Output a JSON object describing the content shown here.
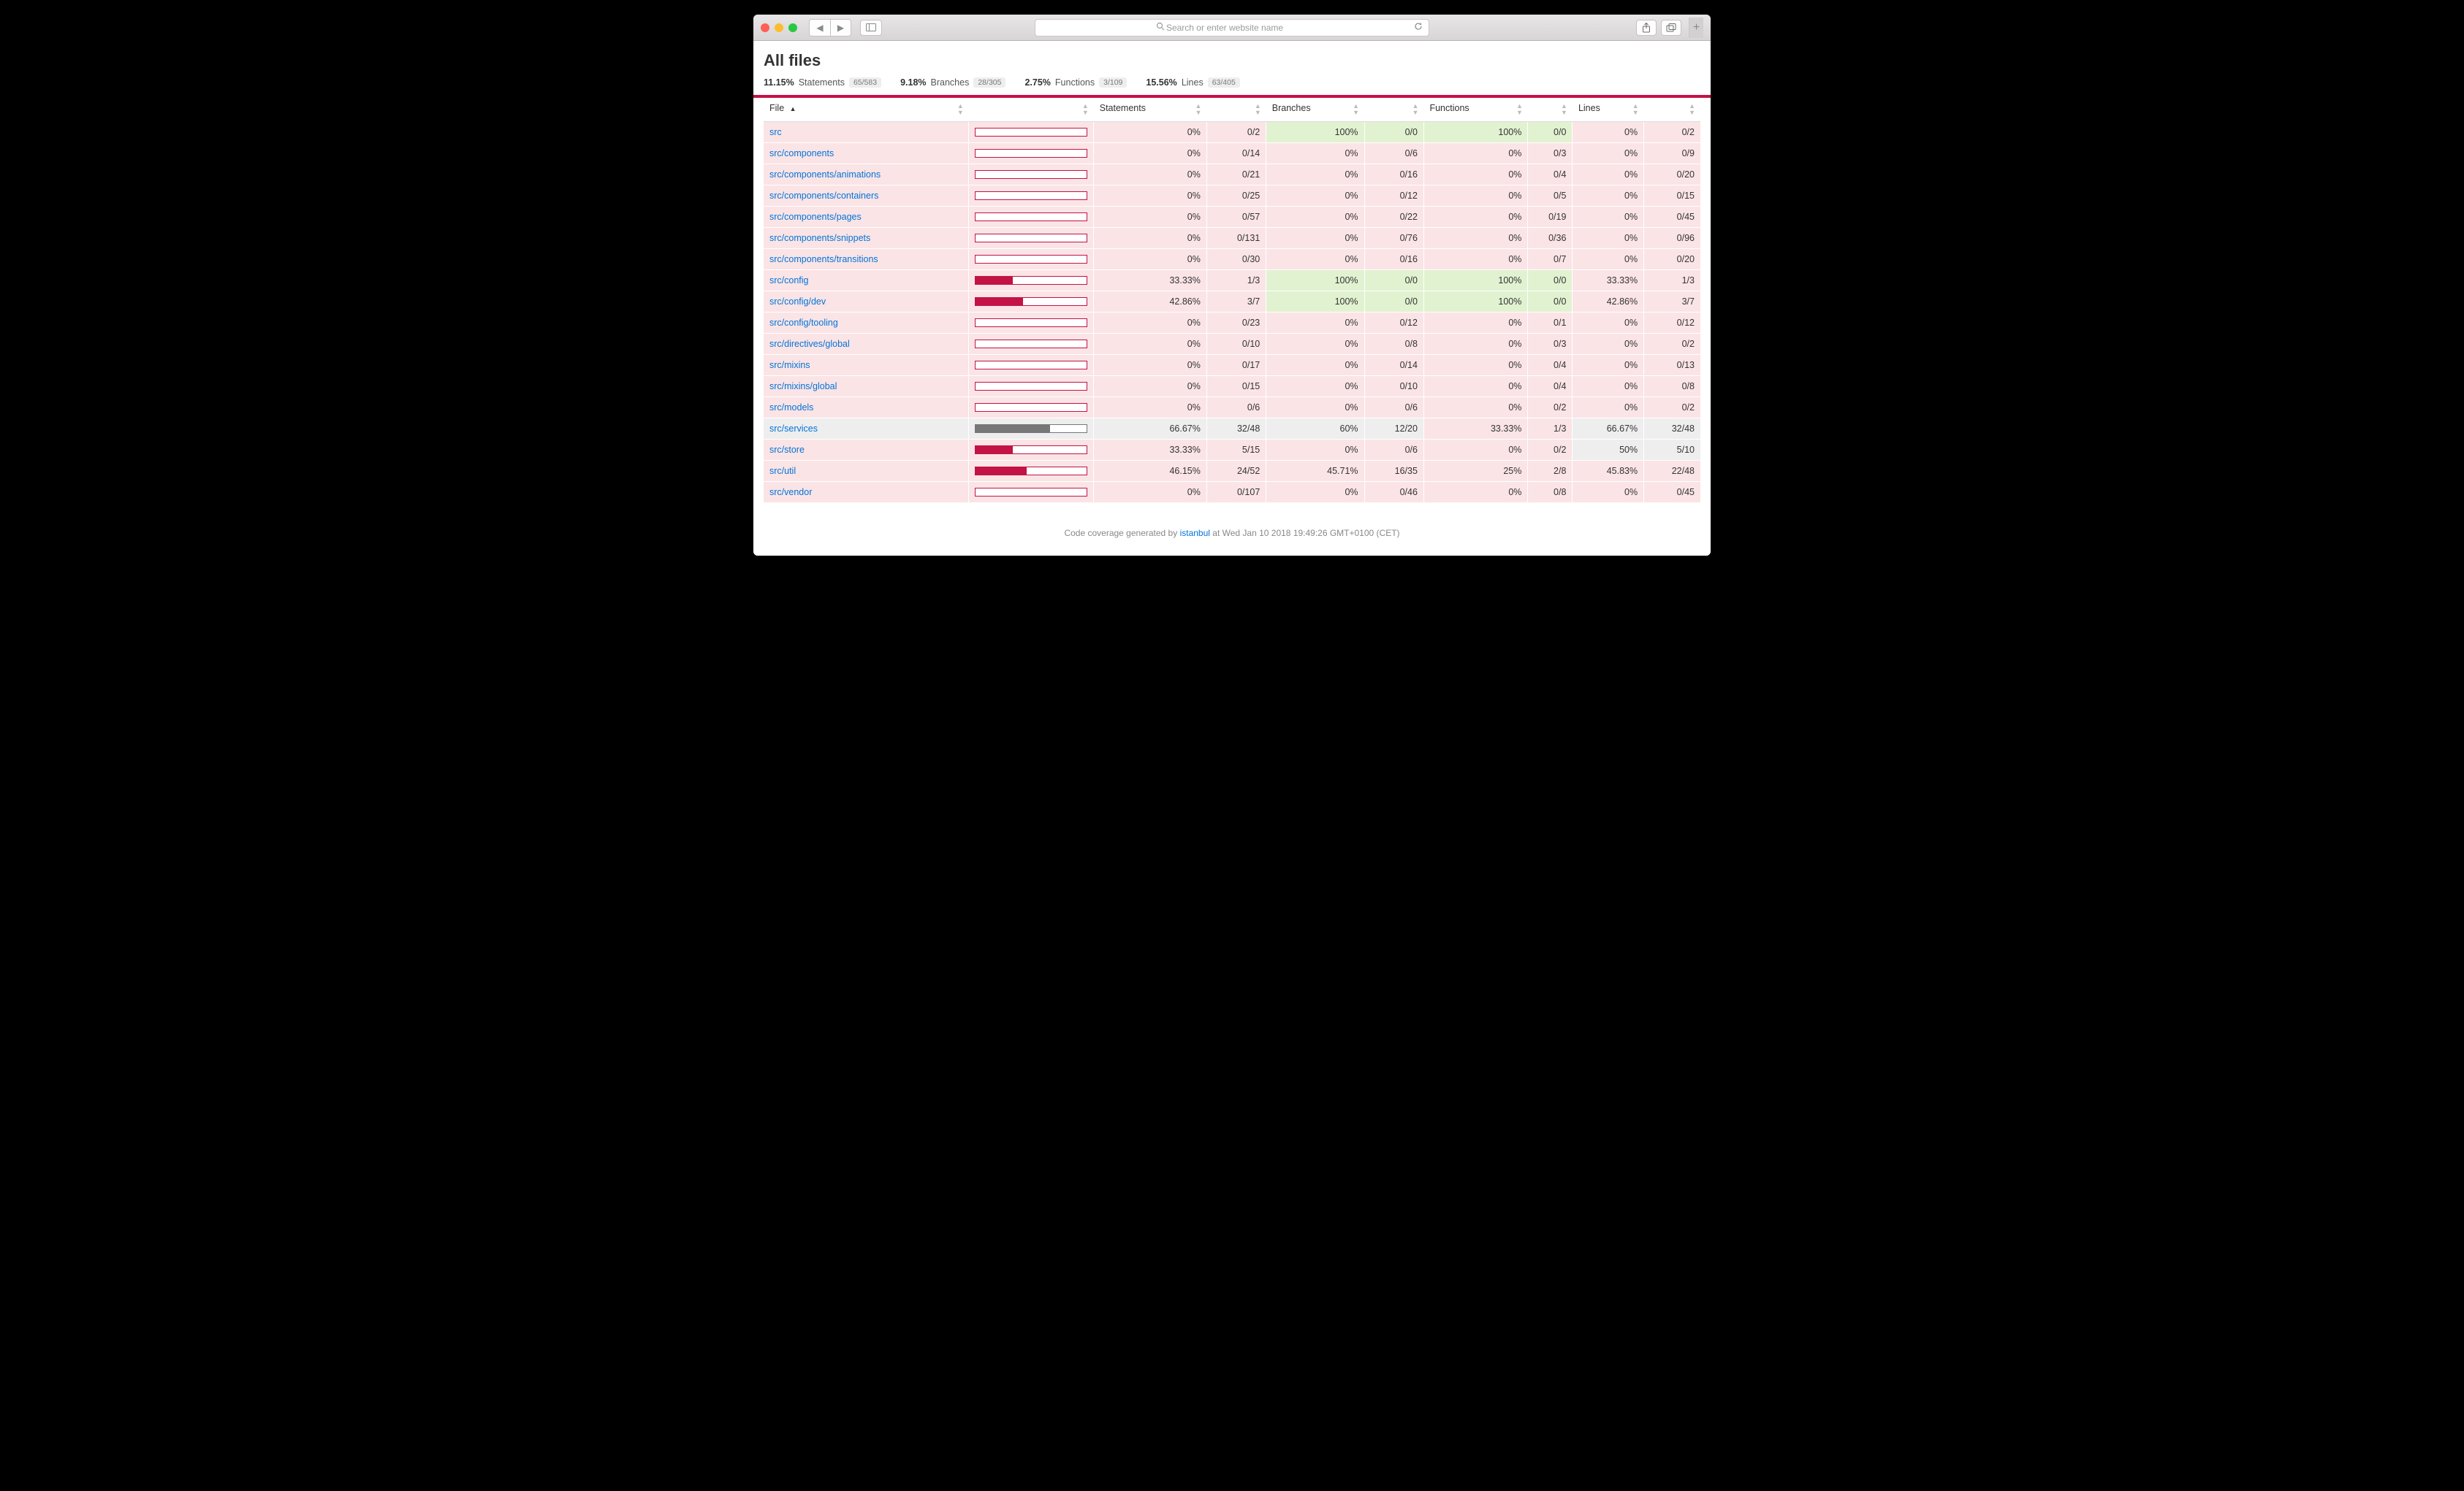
{
  "browser": {
    "url_placeholder": "Search or enter website name"
  },
  "page_title": "All files",
  "summary": [
    {
      "pct": "11.15%",
      "label": "Statements",
      "frac": "65/583"
    },
    {
      "pct": "9.18%",
      "label": "Branches",
      "frac": "28/305"
    },
    {
      "pct": "2.75%",
      "label": "Functions",
      "frac": "3/109"
    },
    {
      "pct": "15.56%",
      "label": "Lines",
      "frac": "63/405"
    }
  ],
  "columns": {
    "file": "File",
    "statements": "Statements",
    "branches": "Branches",
    "functions": "Functions",
    "lines": "Lines"
  },
  "accent": "#c21246",
  "rows": [
    {
      "file": "src",
      "bar": 0,
      "st_pct": "0%",
      "st_frac": "0/2",
      "br_pct": "100%",
      "br_frac": "0/0",
      "fn_pct": "100%",
      "fn_frac": "0/0",
      "ln_pct": "0%",
      "ln_frac": "0/2",
      "cls": {
        "file": "bg-low",
        "bar": "bg-low",
        "st_pct": "bg-low",
        "st_frac": "bg-low",
        "br_pct": "bg-high",
        "br_frac": "bg-high",
        "fn_pct": "bg-high",
        "fn_frac": "bg-high",
        "ln_pct": "bg-low",
        "ln_frac": "bg-low"
      }
    },
    {
      "file": "src/components",
      "bar": 0,
      "st_pct": "0%",
      "st_frac": "0/14",
      "br_pct": "0%",
      "br_frac": "0/6",
      "fn_pct": "0%",
      "fn_frac": "0/3",
      "ln_pct": "0%",
      "ln_frac": "0/9",
      "cls": {
        "file": "bg-low",
        "bar": "bg-low",
        "st_pct": "bg-low",
        "st_frac": "bg-low",
        "br_pct": "bg-low",
        "br_frac": "bg-low",
        "fn_pct": "bg-low",
        "fn_frac": "bg-low",
        "ln_pct": "bg-low",
        "ln_frac": "bg-low"
      }
    },
    {
      "file": "src/components/animations",
      "bar": 0,
      "st_pct": "0%",
      "st_frac": "0/21",
      "br_pct": "0%",
      "br_frac": "0/16",
      "fn_pct": "0%",
      "fn_frac": "0/4",
      "ln_pct": "0%",
      "ln_frac": "0/20",
      "cls": {
        "file": "bg-low",
        "bar": "bg-low",
        "st_pct": "bg-low",
        "st_frac": "bg-low",
        "br_pct": "bg-low",
        "br_frac": "bg-low",
        "fn_pct": "bg-low",
        "fn_frac": "bg-low",
        "ln_pct": "bg-low",
        "ln_frac": "bg-low"
      }
    },
    {
      "file": "src/components/containers",
      "bar": 0,
      "st_pct": "0%",
      "st_frac": "0/25",
      "br_pct": "0%",
      "br_frac": "0/12",
      "fn_pct": "0%",
      "fn_frac": "0/5",
      "ln_pct": "0%",
      "ln_frac": "0/15",
      "cls": {
        "file": "bg-low",
        "bar": "bg-low",
        "st_pct": "bg-low",
        "st_frac": "bg-low",
        "br_pct": "bg-low",
        "br_frac": "bg-low",
        "fn_pct": "bg-low",
        "fn_frac": "bg-low",
        "ln_pct": "bg-low",
        "ln_frac": "bg-low"
      }
    },
    {
      "file": "src/components/pages",
      "bar": 0,
      "st_pct": "0%",
      "st_frac": "0/57",
      "br_pct": "0%",
      "br_frac": "0/22",
      "fn_pct": "0%",
      "fn_frac": "0/19",
      "ln_pct": "0%",
      "ln_frac": "0/45",
      "cls": {
        "file": "bg-low",
        "bar": "bg-low",
        "st_pct": "bg-low",
        "st_frac": "bg-low",
        "br_pct": "bg-low",
        "br_frac": "bg-low",
        "fn_pct": "bg-low",
        "fn_frac": "bg-low",
        "ln_pct": "bg-low",
        "ln_frac": "bg-low"
      }
    },
    {
      "file": "src/components/snippets",
      "bar": 0,
      "st_pct": "0%",
      "st_frac": "0/131",
      "br_pct": "0%",
      "br_frac": "0/76",
      "fn_pct": "0%",
      "fn_frac": "0/36",
      "ln_pct": "0%",
      "ln_frac": "0/96",
      "cls": {
        "file": "bg-low",
        "bar": "bg-low",
        "st_pct": "bg-low",
        "st_frac": "bg-low",
        "br_pct": "bg-low",
        "br_frac": "bg-low",
        "fn_pct": "bg-low",
        "fn_frac": "bg-low",
        "ln_pct": "bg-low",
        "ln_frac": "bg-low"
      }
    },
    {
      "file": "src/components/transitions",
      "bar": 0,
      "st_pct": "0%",
      "st_frac": "0/30",
      "br_pct": "0%",
      "br_frac": "0/16",
      "fn_pct": "0%",
      "fn_frac": "0/7",
      "ln_pct": "0%",
      "ln_frac": "0/20",
      "cls": {
        "file": "bg-low",
        "bar": "bg-low",
        "st_pct": "bg-low",
        "st_frac": "bg-low",
        "br_pct": "bg-low",
        "br_frac": "bg-low",
        "fn_pct": "bg-low",
        "fn_frac": "bg-low",
        "ln_pct": "bg-low",
        "ln_frac": "bg-low"
      }
    },
    {
      "file": "src/config",
      "bar": 33.33,
      "st_pct": "33.33%",
      "st_frac": "1/3",
      "br_pct": "100%",
      "br_frac": "0/0",
      "fn_pct": "100%",
      "fn_frac": "0/0",
      "ln_pct": "33.33%",
      "ln_frac": "1/3",
      "cls": {
        "file": "bg-low",
        "bar": "bg-low",
        "st_pct": "bg-low",
        "st_frac": "bg-low",
        "br_pct": "bg-high",
        "br_frac": "bg-high",
        "fn_pct": "bg-high",
        "fn_frac": "bg-high",
        "ln_pct": "bg-low",
        "ln_frac": "bg-low"
      }
    },
    {
      "file": "src/config/dev",
      "bar": 42.86,
      "st_pct": "42.86%",
      "st_frac": "3/7",
      "br_pct": "100%",
      "br_frac": "0/0",
      "fn_pct": "100%",
      "fn_frac": "0/0",
      "ln_pct": "42.86%",
      "ln_frac": "3/7",
      "cls": {
        "file": "bg-low",
        "bar": "bg-low",
        "st_pct": "bg-low",
        "st_frac": "bg-low",
        "br_pct": "bg-high",
        "br_frac": "bg-high",
        "fn_pct": "bg-high",
        "fn_frac": "bg-high",
        "ln_pct": "bg-low",
        "ln_frac": "bg-low"
      }
    },
    {
      "file": "src/config/tooling",
      "bar": 0,
      "st_pct": "0%",
      "st_frac": "0/23",
      "br_pct": "0%",
      "br_frac": "0/12",
      "fn_pct": "0%",
      "fn_frac": "0/1",
      "ln_pct": "0%",
      "ln_frac": "0/12",
      "cls": {
        "file": "bg-low",
        "bar": "bg-low",
        "st_pct": "bg-low",
        "st_frac": "bg-low",
        "br_pct": "bg-low",
        "br_frac": "bg-low",
        "fn_pct": "bg-low",
        "fn_frac": "bg-low",
        "ln_pct": "bg-low",
        "ln_frac": "bg-low"
      }
    },
    {
      "file": "src/directives/global",
      "bar": 0,
      "st_pct": "0%",
      "st_frac": "0/10",
      "br_pct": "0%",
      "br_frac": "0/8",
      "fn_pct": "0%",
      "fn_frac": "0/3",
      "ln_pct": "0%",
      "ln_frac": "0/2",
      "cls": {
        "file": "bg-low",
        "bar": "bg-low",
        "st_pct": "bg-low",
        "st_frac": "bg-low",
        "br_pct": "bg-low",
        "br_frac": "bg-low",
        "fn_pct": "bg-low",
        "fn_frac": "bg-low",
        "ln_pct": "bg-low",
        "ln_frac": "bg-low"
      }
    },
    {
      "file": "src/mixins",
      "bar": 0,
      "st_pct": "0%",
      "st_frac": "0/17",
      "br_pct": "0%",
      "br_frac": "0/14",
      "fn_pct": "0%",
      "fn_frac": "0/4",
      "ln_pct": "0%",
      "ln_frac": "0/13",
      "cls": {
        "file": "bg-low",
        "bar": "bg-low",
        "st_pct": "bg-low",
        "st_frac": "bg-low",
        "br_pct": "bg-low",
        "br_frac": "bg-low",
        "fn_pct": "bg-low",
        "fn_frac": "bg-low",
        "ln_pct": "bg-low",
        "ln_frac": "bg-low"
      }
    },
    {
      "file": "src/mixins/global",
      "bar": 0,
      "st_pct": "0%",
      "st_frac": "0/15",
      "br_pct": "0%",
      "br_frac": "0/10",
      "fn_pct": "0%",
      "fn_frac": "0/4",
      "ln_pct": "0%",
      "ln_frac": "0/8",
      "cls": {
        "file": "bg-low",
        "bar": "bg-low",
        "st_pct": "bg-low",
        "st_frac": "bg-low",
        "br_pct": "bg-low",
        "br_frac": "bg-low",
        "fn_pct": "bg-low",
        "fn_frac": "bg-low",
        "ln_pct": "bg-low",
        "ln_frac": "bg-low"
      }
    },
    {
      "file": "src/models",
      "bar": 0,
      "st_pct": "0%",
      "st_frac": "0/6",
      "br_pct": "0%",
      "br_frac": "0/6",
      "fn_pct": "0%",
      "fn_frac": "0/2",
      "ln_pct": "0%",
      "ln_frac": "0/2",
      "cls": {
        "file": "bg-low",
        "bar": "bg-low",
        "st_pct": "bg-low",
        "st_frac": "bg-low",
        "br_pct": "bg-low",
        "br_frac": "bg-low",
        "fn_pct": "bg-low",
        "fn_frac": "bg-low",
        "ln_pct": "bg-low",
        "ln_frac": "bg-low"
      }
    },
    {
      "file": "src/services",
      "bar": 66.67,
      "bar_gray": true,
      "st_pct": "66.67%",
      "st_frac": "32/48",
      "br_pct": "60%",
      "br_frac": "12/20",
      "fn_pct": "33.33%",
      "fn_frac": "1/3",
      "ln_pct": "66.67%",
      "ln_frac": "32/48",
      "cls": {
        "file": "bg-med",
        "bar": "bg-med",
        "st_pct": "bg-med",
        "st_frac": "bg-med",
        "br_pct": "bg-med",
        "br_frac": "bg-med",
        "fn_pct": "bg-low",
        "fn_frac": "bg-low",
        "ln_pct": "bg-med",
        "ln_frac": "bg-med"
      }
    },
    {
      "file": "src/store",
      "bar": 33.33,
      "st_pct": "33.33%",
      "st_frac": "5/15",
      "br_pct": "0%",
      "br_frac": "0/6",
      "fn_pct": "0%",
      "fn_frac": "0/2",
      "ln_pct": "50%",
      "ln_frac": "5/10",
      "cls": {
        "file": "bg-low",
        "bar": "bg-low",
        "st_pct": "bg-low",
        "st_frac": "bg-low",
        "br_pct": "bg-low",
        "br_frac": "bg-low",
        "fn_pct": "bg-low",
        "fn_frac": "bg-low",
        "ln_pct": "bg-med",
        "ln_frac": "bg-med"
      }
    },
    {
      "file": "src/util",
      "bar": 46.15,
      "st_pct": "46.15%",
      "st_frac": "24/52",
      "br_pct": "45.71%",
      "br_frac": "16/35",
      "fn_pct": "25%",
      "fn_frac": "2/8",
      "ln_pct": "45.83%",
      "ln_frac": "22/48",
      "cls": {
        "file": "bg-low",
        "bar": "bg-low",
        "st_pct": "bg-low",
        "st_frac": "bg-low",
        "br_pct": "bg-low",
        "br_frac": "bg-low",
        "fn_pct": "bg-low",
        "fn_frac": "bg-low",
        "ln_pct": "bg-low",
        "ln_frac": "bg-low"
      }
    },
    {
      "file": "src/vendor",
      "bar": 0,
      "st_pct": "0%",
      "st_frac": "0/107",
      "br_pct": "0%",
      "br_frac": "0/46",
      "fn_pct": "0%",
      "fn_frac": "0/8",
      "ln_pct": "0%",
      "ln_frac": "0/45",
      "cls": {
        "file": "bg-low",
        "bar": "bg-low",
        "st_pct": "bg-low",
        "st_frac": "bg-low",
        "br_pct": "bg-low",
        "br_frac": "bg-low",
        "fn_pct": "bg-low",
        "fn_frac": "bg-low",
        "ln_pct": "bg-low",
        "ln_frac": "bg-low"
      }
    }
  ],
  "footer": {
    "prefix": "Code coverage generated by ",
    "link_text": "istanbul",
    "suffix": " at Wed Jan 10 2018 19:49:26 GMT+0100 (CET)"
  }
}
